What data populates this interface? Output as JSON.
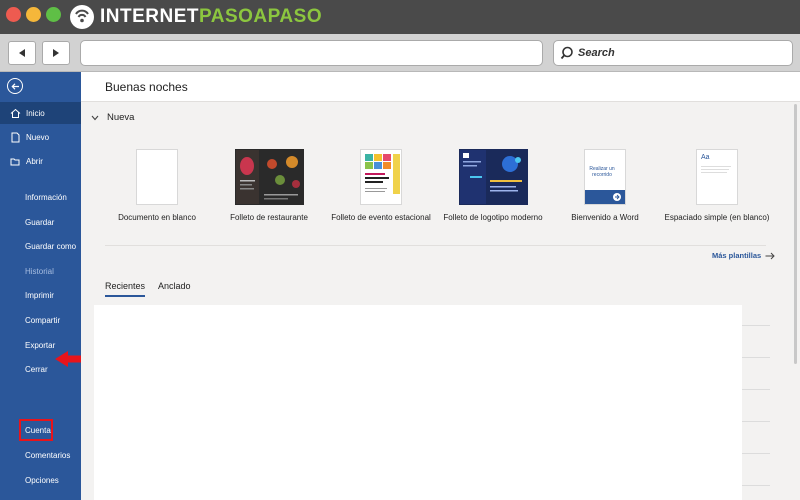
{
  "site": {
    "logo_prefix": "INTERNET",
    "logo_highlight": "PASOAPASO"
  },
  "browser": {
    "search_placeholder": "Search"
  },
  "header": {
    "greeting": "Buenas noches"
  },
  "new_section": {
    "label": "Nueva",
    "templates": [
      {
        "name": "Documento en blanco"
      },
      {
        "name": "Folleto de restaurante"
      },
      {
        "name": "Folleto de evento estacional"
      },
      {
        "name": "Folleto de logotipo moderno"
      },
      {
        "name": "Bienvenido a Word",
        "thumb_text": "Realizar un recorrido"
      },
      {
        "name": "Espaciado simple (en blanco)",
        "thumb_text": "Aa"
      }
    ],
    "more_link": "Más plantillas"
  },
  "tabs": [
    {
      "label": "Recientes"
    },
    {
      "label": "Anclado"
    }
  ],
  "sidebar": {
    "items": [
      {
        "label": "Inicio",
        "icon": "home-icon",
        "state": "active"
      },
      {
        "label": "Nuevo",
        "icon": "new-document-icon"
      },
      {
        "label": "Abrir",
        "icon": "open-folder-icon"
      },
      {
        "label": "Información"
      },
      {
        "label": "Guardar"
      },
      {
        "label": "Guardar como"
      },
      {
        "label": "Historial",
        "state": "disabled"
      },
      {
        "label": "Imprimir"
      },
      {
        "label": "Compartir"
      },
      {
        "label": "Exportar"
      },
      {
        "label": "Cerrar"
      },
      {
        "label": "Cuenta",
        "state": "highlighted"
      },
      {
        "label": "Comentarios"
      },
      {
        "label": "Opciones"
      }
    ]
  },
  "colors": {
    "word_blue": "#2b579a",
    "highlight_red": "#e8141b",
    "logo_green": "#8cc63f"
  }
}
